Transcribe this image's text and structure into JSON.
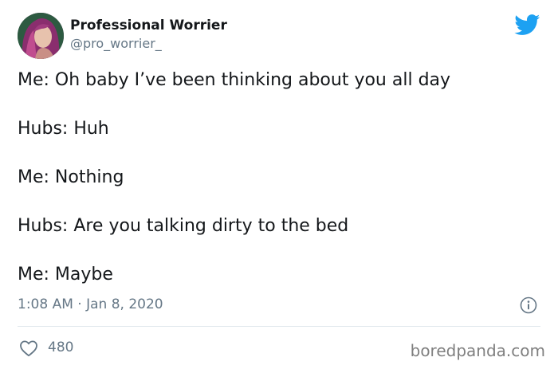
{
  "tweet": {
    "author": {
      "display_name": "Professional Worrier",
      "handle": "@pro_worrier_"
    },
    "lines": [
      "Me: Oh baby I’ve been thinking about you all day",
      "Hubs: Huh",
      "Me: Nothing",
      "Hubs: Are you talking dirty to the bed",
      "Me: Maybe"
    ],
    "timestamp": "1:08 AM · Jan 8, 2020",
    "likes": "480"
  },
  "watermark": "boredpanda.com",
  "icons": {
    "brand": "twitter-bird-icon",
    "info": "info-icon",
    "like": "heart-icon"
  },
  "colors": {
    "twitter_blue": "#1da1f2",
    "secondary_text": "#657786",
    "divider": "#e1e8ed"
  }
}
